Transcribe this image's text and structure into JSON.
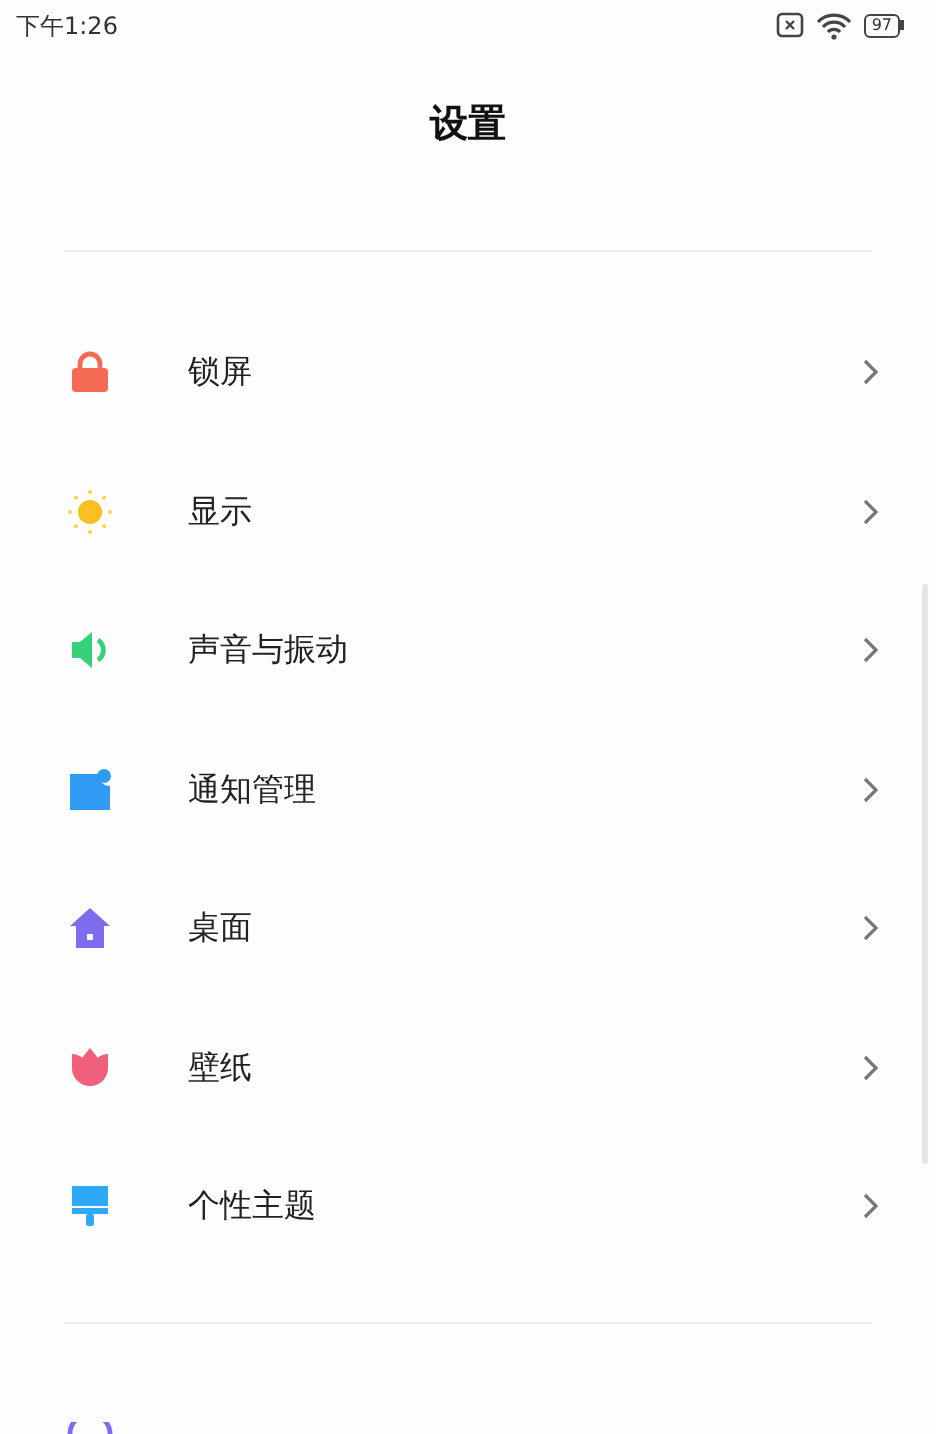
{
  "status_bar": {
    "time": "下午1:26",
    "battery": "97"
  },
  "title": "设置",
  "items": [
    {
      "label": "锁屏",
      "kind": "lock"
    },
    {
      "label": "显示",
      "kind": "sun"
    },
    {
      "label": "声音与振动",
      "kind": "speaker"
    },
    {
      "label": "通知管理",
      "kind": "notify"
    },
    {
      "label": "桌面",
      "kind": "home"
    },
    {
      "label": "壁纸",
      "kind": "flower"
    },
    {
      "label": "个性主题",
      "kind": "brush"
    }
  ]
}
